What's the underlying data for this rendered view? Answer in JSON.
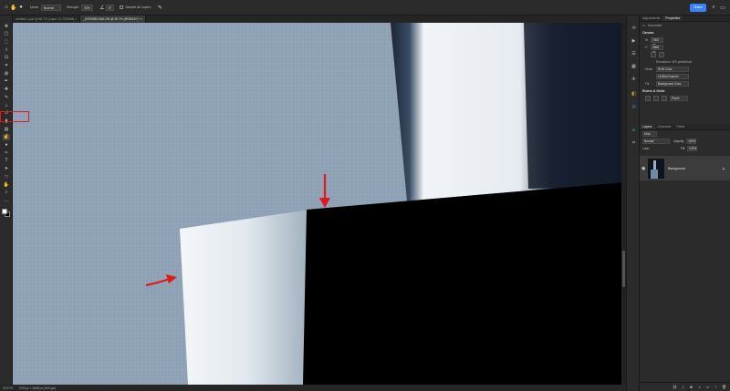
{
  "options_bar": {
    "mode_label": "Mode:",
    "mode_value": "Normal",
    "strength_label": "Strength:",
    "strength_value": "20%",
    "angle_value": "0°",
    "sample_label": "Sample All Layers"
  },
  "share_label": "Share",
  "tabs": [
    {
      "label": "Untitled-1.psd @ 66.7% (Layer 10, RGB/8#) ×",
      "active": false
    },
    {
      "label": "_DSF8280-Edit-2.tif @ 25.7% (RGB/16*) * ×",
      "active": true
    }
  ],
  "status": {
    "zoom": "25.67%",
    "info": "7000 px x 4668 px (300 ppi)"
  },
  "panels": {
    "top_tabs": [
      "Adjustments",
      "Properties"
    ],
    "top_active": 1,
    "document_label": "Document",
    "canvas_section": "Canvas",
    "width_label": "W",
    "width_value": "7000 px",
    "height_label": "H",
    "height_value": "4668 px",
    "resolution_text": "Resolution: 300 pixels/inch",
    "mode_label": "Mode",
    "mode_value": "RGB Color",
    "depth_value": "16 Bits/Channel",
    "fill_label": "Fill",
    "fill_value": "Background Color",
    "rulers_section": "Rulers & Grids",
    "units_value": "Pixels",
    "layer_tabs": [
      "Layers",
      "Channels",
      "Paths"
    ],
    "layer_tab_active": 0,
    "kind_value": "Kind",
    "blend_value": "Normal",
    "opacity_label": "Opacity:",
    "opacity_value": "100%",
    "lock_label": "Lock:",
    "fill2_label": "Fill:",
    "fill2_value": "100%",
    "background_layer": "Background"
  },
  "colors": {
    "canvas_light": "#8fa2b6",
    "highlight_red": "#e0191b",
    "accent_blue": "#3b82f6"
  },
  "tools": [
    "move-icon",
    "artboard-icon",
    "marquee-icon",
    "lasso-icon",
    "object-select-icon",
    "crop-icon",
    "frame-icon",
    "eyedropper-icon",
    "spot-heal-icon",
    "brush-icon",
    "clone-stamp-icon",
    "history-brush-icon",
    "eraser-icon",
    "gradient-icon",
    "smudge-icon",
    "dodge-icon",
    "pen-icon",
    "type-icon",
    "path-select-icon",
    "rectangle-icon",
    "hand-icon",
    "zoom-icon",
    "more-tools-icon"
  ]
}
